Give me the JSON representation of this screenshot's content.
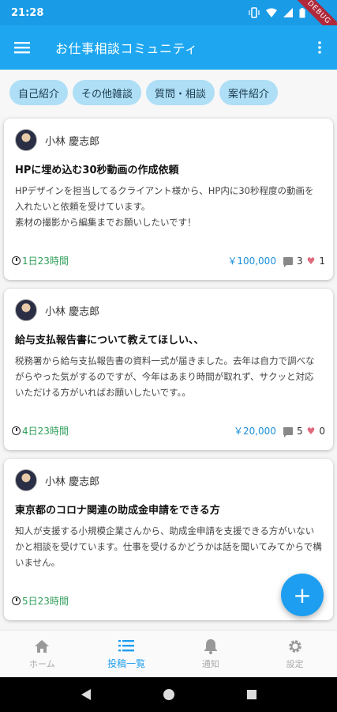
{
  "status_bar": {
    "time": "21:28",
    "debug_label": "DEBUG"
  },
  "app_bar": {
    "title": "お仕事相談コミュニティ"
  },
  "chips": [
    "自己紹介",
    "その他雑談",
    "質問・相談",
    "案件紹介"
  ],
  "posts": [
    {
      "author": "小林 慶志郎",
      "title": "HPに埋め込む30秒動画の作成依頼",
      "body": "HPデザインを担当してるクライアント様から、HP内に30秒程度の動画を入れたいと依頼を受けています。\n素材の撮影から編集までお願いしたいです！",
      "deadline": "1日23時間",
      "price": "￥100,000",
      "comments": "3",
      "likes": "1"
    },
    {
      "author": "小林 慶志郎",
      "title": "給与支払報告書について教えてほしい、、",
      "body": "税務署から給与支払報告書の資料一式が届きました。去年は自力で調べながらやった気がするのですが、今年はあまり時間が取れず、サクッと対応いただける方がいればお願いしたいです。。",
      "deadline": "4日23時間",
      "price": "￥20,000",
      "comments": "5",
      "likes": "0"
    },
    {
      "author": "小林 慶志郎",
      "title": "東京都のコロナ関連の助成金申請をできる方",
      "body": "知人が支援する小規模企業さんから、助成金申請を支援できる方がいないかと相談を受けています。仕事を受けるかどうかは話を聞いてみてからで構いません。",
      "deadline": "5日23時間",
      "price": "",
      "comments": "",
      "likes": ""
    }
  ],
  "fab": {
    "label": "+"
  },
  "bottom_nav": [
    {
      "label": "ホーム",
      "icon": "home-icon",
      "active": false
    },
    {
      "label": "投稿一覧",
      "icon": "list-icon",
      "active": true
    },
    {
      "label": "通知",
      "icon": "bell-icon",
      "active": false
    },
    {
      "label": "設定",
      "icon": "gear-icon",
      "active": false
    }
  ],
  "colors": {
    "primary": "#1ea7f0",
    "chip": "#aedff7",
    "deadline": "#2e9e58",
    "price": "#1b8fdc",
    "heart": "#e06a7c"
  }
}
